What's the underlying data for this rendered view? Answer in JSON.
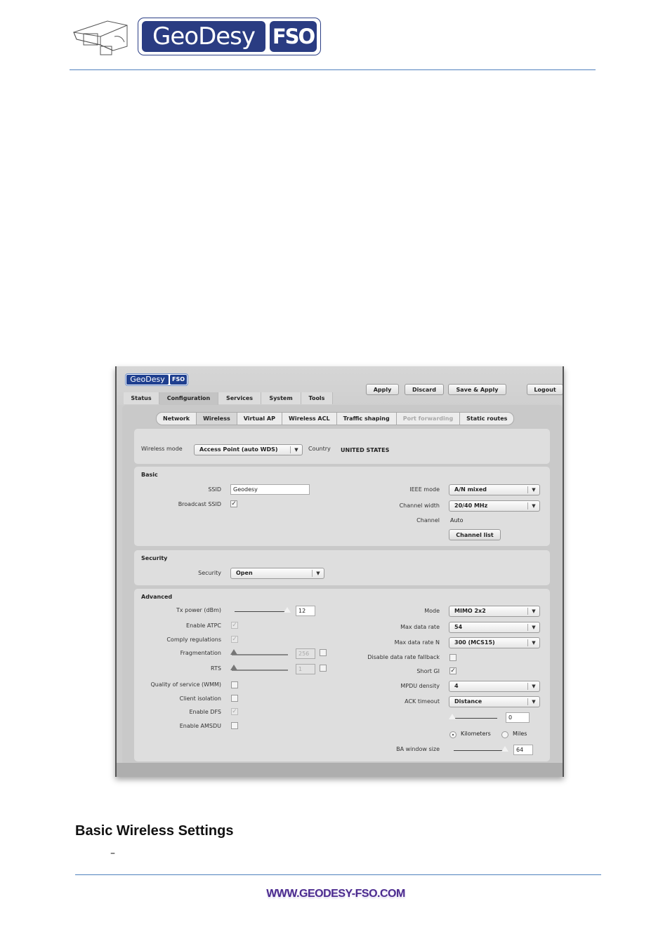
{
  "document": {
    "logo": {
      "brand": "GeoDesy",
      "suffix": "FSO"
    },
    "heading": "Basic Wireless Settings",
    "dash": "–",
    "footer_url": "WWW.GEODESY-FSO.COM"
  },
  "ui": {
    "logo": {
      "brand": "GeoDesy",
      "suffix": "FSO"
    },
    "tabs": [
      {
        "label": "Status"
      },
      {
        "label": "Configuration",
        "active": true
      },
      {
        "label": "Services"
      },
      {
        "label": "System"
      },
      {
        "label": "Tools"
      }
    ],
    "buttons": {
      "apply": "Apply",
      "discard": "Discard",
      "save_apply": "Save & Apply",
      "logout": "Logout"
    },
    "subtabs": [
      {
        "label": "Network"
      },
      {
        "label": "Wireless",
        "active": true
      },
      {
        "label": "Virtual AP"
      },
      {
        "label": "Wireless ACL"
      },
      {
        "label": "Traffic shaping"
      },
      {
        "label": "Port forwarding",
        "disabled": true
      },
      {
        "label": "Static routes"
      }
    ],
    "mode_row": {
      "wireless_mode_label": "Wireless mode",
      "wireless_mode_value": "Access Point (auto WDS)",
      "country_label": "Country",
      "country_value": "UNITED STATES"
    },
    "basic": {
      "title": "Basic",
      "ssid_label": "SSID",
      "ssid_value": "Geodesy",
      "broadcast_ssid_label": "Broadcast SSID",
      "broadcast_ssid_checked": true,
      "ieee_mode_label": "IEEE mode",
      "ieee_mode_value": "A/N mixed",
      "channel_width_label": "Channel width",
      "channel_width_value": "20/40 MHz",
      "channel_label": "Channel",
      "channel_value": "Auto",
      "channel_list_button": "Channel list"
    },
    "security": {
      "title": "Security",
      "security_label": "Security",
      "security_value": "Open"
    },
    "advanced": {
      "title": "Advanced",
      "tx_power_label": "Tx power (dBm)",
      "tx_power_value": "12",
      "enable_atpc_label": "Enable ATPC",
      "comply_regulations_label": "Comply regulations",
      "fragmentation_label": "Fragmentation",
      "fragmentation_value": "256",
      "rts_label": "RTS",
      "rts_value": "1",
      "qos_label": "Quality of service (WMM)",
      "client_isolation_label": "Client isolation",
      "enable_dfs_label": "Enable DFS",
      "enable_amsdu_label": "Enable AMSDU",
      "mode_label": "Mode",
      "mode_value": "MIMO 2x2",
      "max_data_rate_label": "Max data rate",
      "max_data_rate_value": "54",
      "max_data_rate_n_label": "Max data rate N",
      "max_data_rate_n_value": "300 (MCS15)",
      "disable_fallback_label": "Disable data rate fallback",
      "short_gi_label": "Short GI",
      "mpdu_density_label": "MPDU density",
      "mpdu_density_value": "4",
      "ack_timeout_label": "ACK timeout",
      "ack_timeout_value": "Distance",
      "distance_value": "0",
      "unit_km": "Kilometers",
      "unit_miles": "Miles",
      "ba_window_label": "BA window size",
      "ba_window_value": "64"
    }
  }
}
